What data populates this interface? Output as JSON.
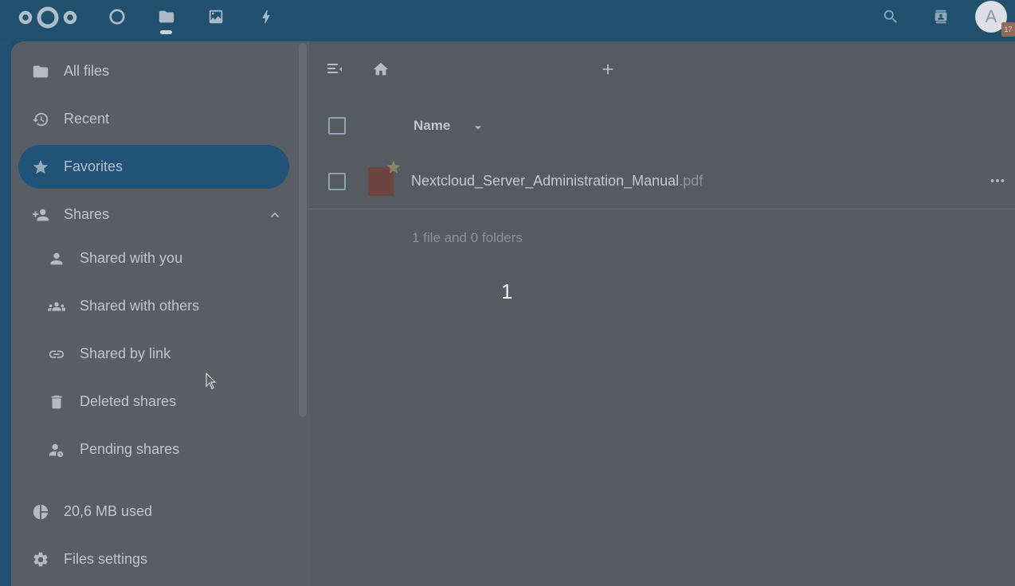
{
  "header": {
    "apps": [
      "dashboard-icon",
      "files-icon",
      "photos-icon",
      "activity-icon"
    ],
    "right_icons": [
      "search-icon",
      "contacts-icon"
    ],
    "avatar_letter": "A",
    "avatar_badge": "17"
  },
  "sidebar": {
    "items": [
      {
        "label": "All files",
        "icon": "folder-icon"
      },
      {
        "label": "Recent",
        "icon": "history-icon"
      },
      {
        "label": "Favorites",
        "icon": "star-icon"
      },
      {
        "label": "Shares",
        "icon": "share-icon"
      },
      {
        "label": "Shared with you",
        "icon": "user-icon"
      },
      {
        "label": "Shared with others",
        "icon": "group-icon"
      },
      {
        "label": "Shared by link",
        "icon": "link-icon"
      },
      {
        "label": "Deleted shares",
        "icon": "trash-icon"
      },
      {
        "label": "Pending shares",
        "icon": "pending-icon"
      }
    ],
    "quota": "20,6 MB used",
    "settings": "Files settings",
    "active": "Favorites"
  },
  "main": {
    "column_name": "Name",
    "file": {
      "base": "Nextcloud_Server_Administration_Manual",
      "ext": ".pdf"
    },
    "summary": "1 file and 0 folders",
    "overlay_number": "1"
  },
  "colors": {
    "header": "#21506f",
    "active_nav": "#215378",
    "content_bg": "#565a61"
  }
}
